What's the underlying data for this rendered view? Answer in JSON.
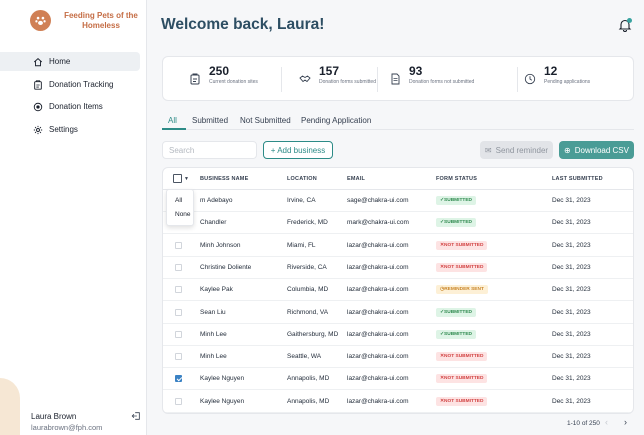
{
  "sidebar": {
    "brand": "Feeding Pets of the Homeless",
    "nav": [
      {
        "label": "Home",
        "icon": "home-icon",
        "active": true
      },
      {
        "label": "Donation Tracking",
        "icon": "clipboard-icon",
        "active": false
      },
      {
        "label": "Donation Items",
        "icon": "target-icon",
        "active": false
      },
      {
        "label": "Settings",
        "icon": "gear-icon",
        "active": false
      }
    ],
    "user": {
      "name": "Laura Brown",
      "email": "laurabrown@fph.com"
    }
  },
  "header": {
    "title": "Welcome back, Laura!"
  },
  "stats": [
    {
      "value": "250",
      "caption": "Current donation sites",
      "icon": "clipboard-icon"
    },
    {
      "value": "157",
      "caption": "Donation forms submitted",
      "icon": "handshake-icon"
    },
    {
      "value": "93",
      "caption": "Donation forms not submitted",
      "icon": "document-icon"
    },
    {
      "value": "12",
      "caption": "Pending applications",
      "icon": "clock-icon"
    }
  ],
  "tabs": [
    "All",
    "Submitted",
    "Not Submitted",
    "Pending Application"
  ],
  "toolbar": {
    "search_placeholder": "Search",
    "add_label": "+ Add business",
    "remind_label": "Send reminder",
    "csv_label": "Download CSV"
  },
  "table": {
    "headers": [
      "BUSINESS NAME",
      "LOCATION",
      "EMAIL",
      "FORM STATUS",
      "LAST SUBMITTED"
    ],
    "rows": [
      {
        "name": "m Adebayo",
        "location": "Irvine, CA",
        "email": "sage@chakra-ui.com",
        "status": "SUBMITTED",
        "date": "Dec 31, 2023",
        "checked": false
      },
      {
        "name": "Chandler",
        "location": "Frederick, MD",
        "email": "mark@chakra-ui.com",
        "status": "SUBMITTED",
        "date": "Dec 31, 2023",
        "checked": false
      },
      {
        "name": "Minh Johnson",
        "location": "Miami, FL",
        "email": "lazar@chakra-ui.com",
        "status": "NOT SUBMITTED",
        "date": "Dec 31, 2023",
        "checked": false
      },
      {
        "name": "Christine Doliente",
        "location": "Riverside, CA",
        "email": "lazar@chakra-ui.com",
        "status": "NOT SUBMITTED",
        "date": "Dec 31, 2023",
        "checked": false
      },
      {
        "name": "Kaylee Pak",
        "location": "Columbia, MD",
        "email": "lazar@chakra-ui.com",
        "status": "REMINDER SENT",
        "date": "Dec 31, 2023",
        "checked": false
      },
      {
        "name": "Sean Liu",
        "location": "Richmond, VA",
        "email": "lazar@chakra-ui.com",
        "status": "SUBMITTED",
        "date": "Dec 31, 2023",
        "checked": false
      },
      {
        "name": "Minh Lee",
        "location": "Gaithersburg, MD",
        "email": "lazar@chakra-ui.com",
        "status": "SUBMITTED",
        "date": "Dec 31, 2023",
        "checked": false
      },
      {
        "name": "Minh Lee",
        "location": "Seattle, WA",
        "email": "lazar@chakra-ui.com",
        "status": "NOT SUBMITTED",
        "date": "Dec 31, 2023",
        "checked": false
      },
      {
        "name": "Kaylee Nguyen",
        "location": "Annapolis, MD",
        "email": "lazar@chakra-ui.com",
        "status": "NOT SUBMITTED",
        "date": "Dec 31, 2023",
        "checked": true
      },
      {
        "name": "Kaylee Nguyen",
        "location": "Annapolis, MD",
        "email": "lazar@chakra-ui.com",
        "status": "NOT SUBMITTED",
        "date": "Dec 31, 2023",
        "checked": false
      }
    ]
  },
  "select_menu": [
    "All",
    "None"
  ],
  "pagination": {
    "label": "1-10 of 250",
    "prev": "‹",
    "next": "›"
  },
  "colors": {
    "brand": "#c56d45",
    "accent": "#2d8b87",
    "title": "#2d4e63"
  }
}
